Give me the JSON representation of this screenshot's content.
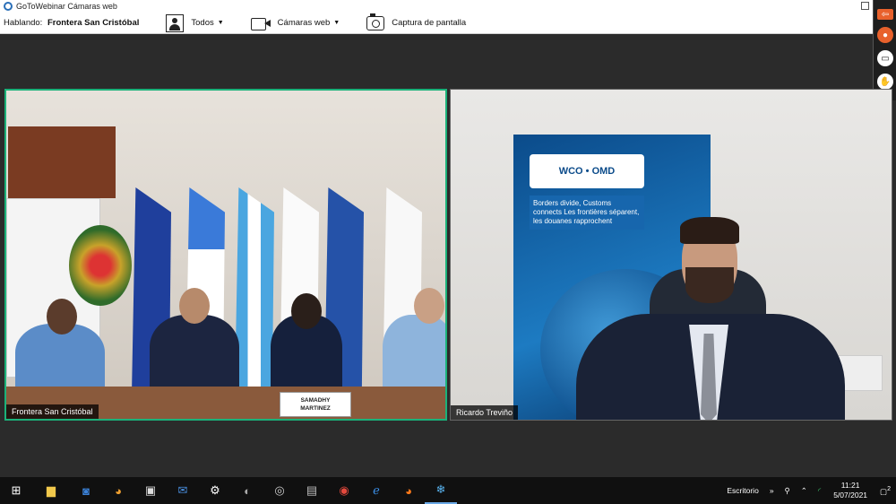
{
  "window": {
    "title": "GoToWebinar Cámaras web"
  },
  "toolbar": {
    "speaking_label": "Hablando:",
    "speaking_name": "Frontera San Cristóbal",
    "all_label": "Todos",
    "webcams_label": "Cámaras web",
    "screenshot_label": "Captura de pantalla"
  },
  "videos": {
    "left": {
      "label": "Frontera San Cristóbal",
      "nameplate_line1": "SAMADHY",
      "nameplate_line2": "MARTINEZ"
    },
    "right": {
      "label": "Ricardo Treviño",
      "banner_logo": "WCO • OMD",
      "banner_slogan": "Borders divide, Customs connects Les frontières séparent, les douanes rapprochent"
    }
  },
  "taskbar": {
    "apps": [
      "windows-start-icon",
      "file-explorer-icon",
      "outlook-icon",
      "paint-icon",
      "store-icon",
      "mail-icon",
      "settings-icon",
      "app-icon",
      "app-icon",
      "document-icon",
      "chrome-icon",
      "edge-icon",
      "firefox-icon",
      "gotowebinar-icon"
    ],
    "desktop_label": "Escritorio",
    "time": "11:21",
    "date": "5/07/2021",
    "notification_count": "2"
  },
  "colors": {
    "active_speaker_border": "#1bb27a",
    "panel_accent": "#e8612c"
  }
}
